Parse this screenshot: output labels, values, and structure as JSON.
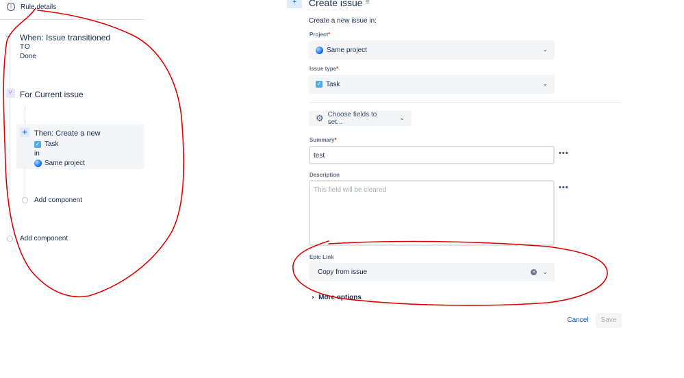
{
  "left_panel": {
    "rule_details": "Rule details",
    "trigger": {
      "title": "When: Issue transitioned",
      "to_label": "TO",
      "status": "Done"
    },
    "branch": {
      "title": "For Current issue"
    },
    "action": {
      "title": "Then: Create a new",
      "issue_type": "Task",
      "in_label": "in",
      "project": "Same project"
    },
    "add_component_inner": "Add component",
    "add_component_outer": "Add component"
  },
  "form": {
    "header_title": "Create issue",
    "create_in_label": "Create a new issue in:",
    "project": {
      "label": "Project",
      "required": "*",
      "value": "Same project"
    },
    "issue_type": {
      "label": "Issue type",
      "required": "*",
      "value": "Task"
    },
    "choose_fields_label": "Choose fields to set...",
    "summary": {
      "label": "Summary",
      "required": "*",
      "value": "test"
    },
    "description": {
      "label": "Description",
      "placeholder": "This field will be cleared"
    },
    "epic_link": {
      "label": "Epic Link",
      "value": "Copy from issue"
    },
    "more_options": "More options",
    "more_actions_glyph": "•••",
    "cancel_label": "Cancel",
    "save_label": "Save"
  },
  "colors": {
    "accent": "#0052cc",
    "required": "#de350b",
    "annotation": "#e00000"
  }
}
